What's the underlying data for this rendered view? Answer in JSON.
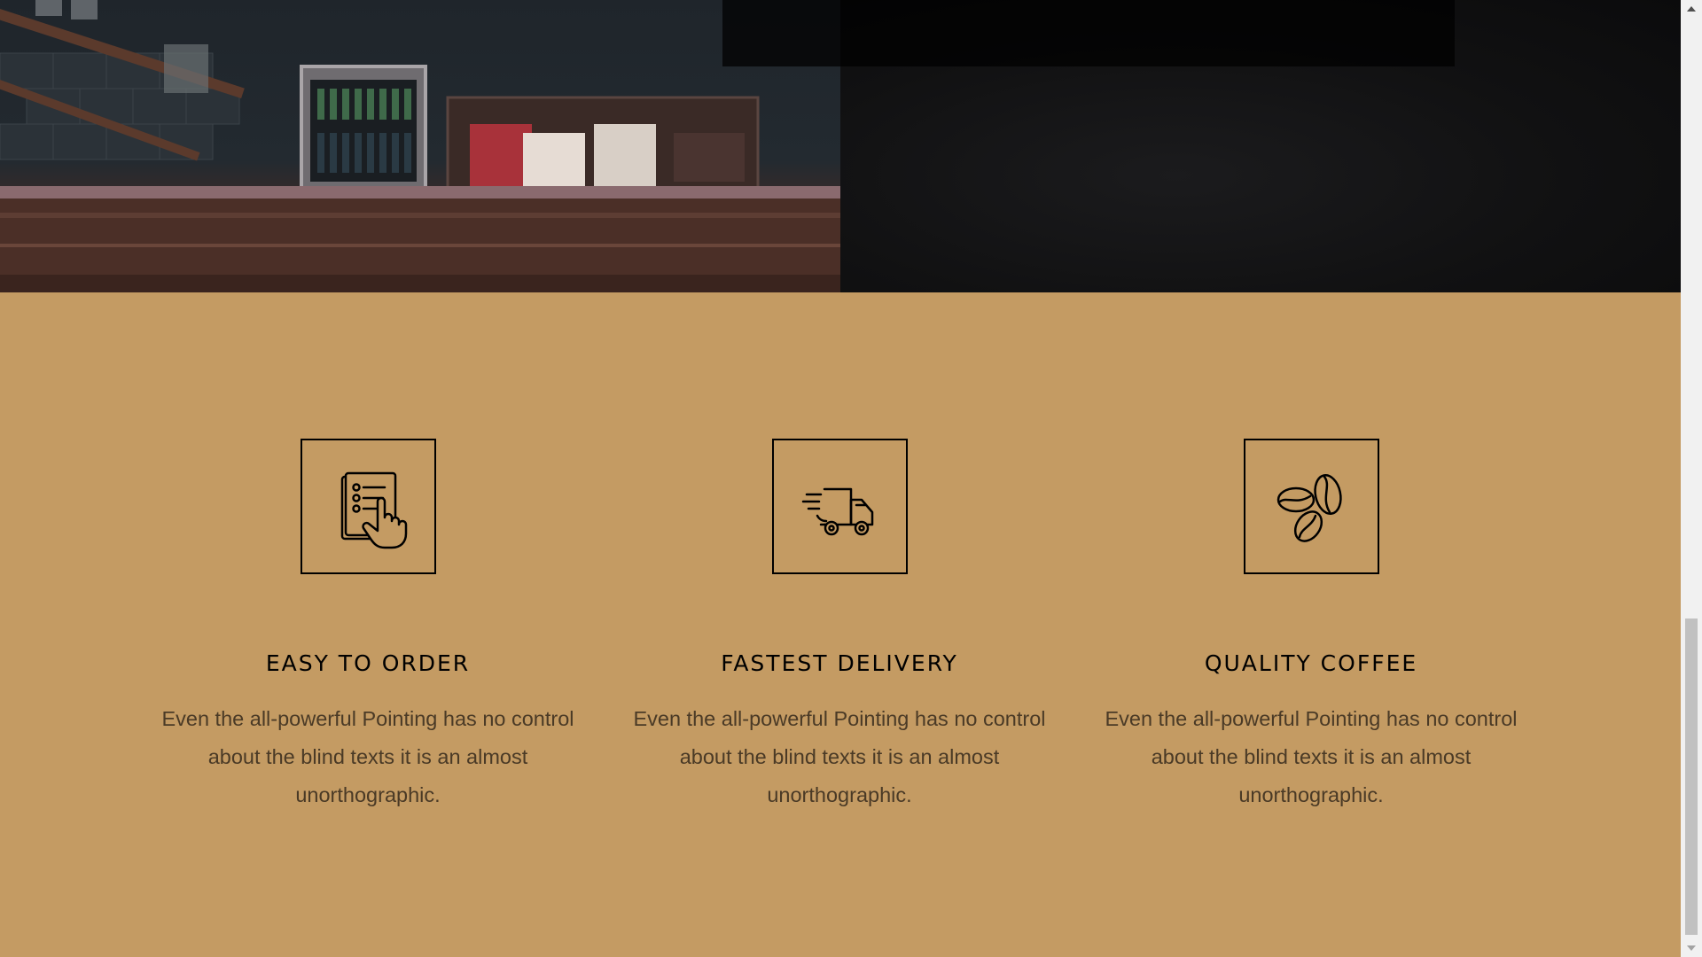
{
  "hero": {
    "photo": "coffee-shop-counter-photo"
  },
  "services": [
    {
      "icon": "order-checklist-icon",
      "title": "EASY TO ORDER",
      "text": "Even the all-powerful Pointing has no control about the blind texts it is an almost unorthographic."
    },
    {
      "icon": "delivery-truck-icon",
      "title": "FASTEST DELIVERY",
      "text": "Even the all-powerful Pointing has no control about the blind texts it is an almost unorthographic."
    },
    {
      "icon": "coffee-beans-icon",
      "title": "QUALITY COFFEE",
      "text": "Even the all-powerful Pointing has no control about the blind texts it is an almost unorthographic."
    }
  ],
  "colors": {
    "section_background": "#c49b63",
    "hero_background": "#0e0e0f",
    "text_title": "#000000",
    "text_body": "#4a3a26"
  },
  "scrollbar": {
    "up_icon": "scroll-up-arrow-icon",
    "down_icon": "scroll-down-arrow-icon"
  }
}
